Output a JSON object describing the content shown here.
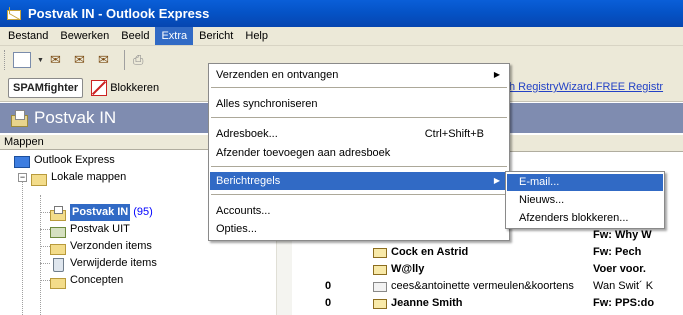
{
  "window": {
    "title": "Postvak IN - Outlook Express"
  },
  "menubar": {
    "items": [
      "Bestand",
      "Bewerken",
      "Beeld",
      "Extra",
      "Bericht",
      "Help"
    ],
    "active": "Extra"
  },
  "linkbar": {
    "spamfighter_label": "SPAMfighter",
    "block_label": "Blokkeren",
    "registry_link": "h RegistryWizard.FREE Registr"
  },
  "folder_header": {
    "title": "Postvak IN"
  },
  "folder_pane": {
    "title": "Mappen",
    "items": [
      {
        "label": "Outlook Express",
        "icon": "outlook-express-icon"
      },
      {
        "label": "Lokale mappen",
        "icon": "local-folders-icon"
      },
      {
        "label": "Postvak IN",
        "count": "(95)",
        "icon": "inbox-icon",
        "selected": true
      },
      {
        "label": "Postvak UIT",
        "icon": "outbox-icon"
      },
      {
        "label": "Verzonden items",
        "icon": "sent-items-icon"
      },
      {
        "label": "Verwijderde items",
        "icon": "deleted-items-icon"
      },
      {
        "label": "Concepten",
        "icon": "drafts-icon"
      }
    ]
  },
  "messages": [
    {
      "attachment": "",
      "from": "Cock en Astrid",
      "subject": "Fw: Pech",
      "unread": true
    },
    {
      "attachment": "",
      "from": "W@lly",
      "subject": "Voer voor.",
      "unread": true
    },
    {
      "attachment": "0",
      "from": "cees&antoinette vermeulen&koortens",
      "subject": "Wan Swit´ K",
      "unread": false
    },
    {
      "attachment": "0",
      "from": "Jeanne Smith",
      "subject": "Fw: PPS:do",
      "unread": true
    }
  ],
  "partial_subject_top": "Fw: Why W",
  "extra_menu": {
    "items": [
      {
        "label": "Verzenden en ontvangen",
        "submenu": true
      },
      {
        "label": "Alles synchroniseren"
      },
      {
        "label": "Adresboek...",
        "shortcut": "Ctrl+Shift+B"
      },
      {
        "label": "Afzender toevoegen aan adresboek"
      },
      {
        "label": "Berichtregels",
        "submenu": true,
        "highlighted": true
      },
      {
        "label": "Accounts..."
      },
      {
        "label": "Opties..."
      }
    ]
  },
  "submenu_berichtregels": {
    "items": [
      {
        "label": "E-mail...",
        "highlighted": true
      },
      {
        "label": "Nieuws..."
      },
      {
        "label": "Afzenders blokkeren..."
      }
    ]
  },
  "colors": {
    "selection": "#316ac5",
    "titlebar": "#0553c7",
    "folder_header": "#7f8cb0"
  }
}
